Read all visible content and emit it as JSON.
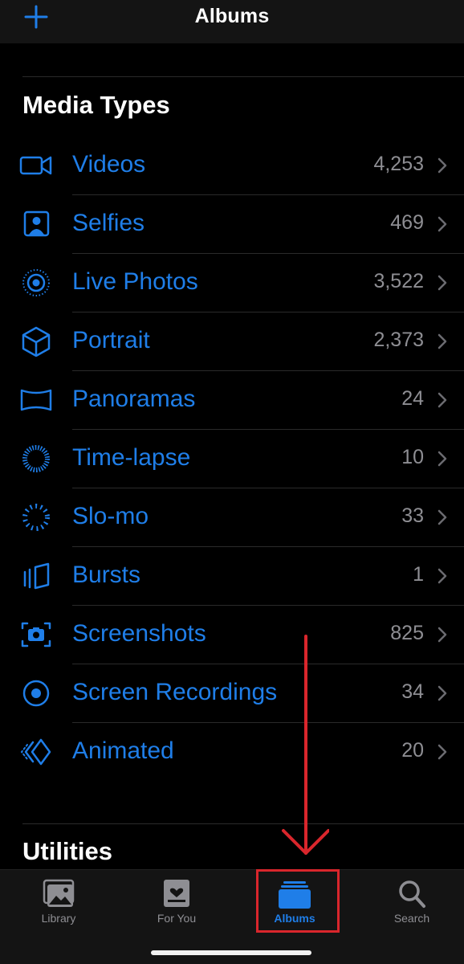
{
  "header": {
    "title": "Albums",
    "add_icon": "plus-icon"
  },
  "media_types": {
    "title": "Media Types",
    "items": [
      {
        "label": "Videos",
        "count": "4,253",
        "icon": "video-icon"
      },
      {
        "label": "Selfies",
        "count": "469",
        "icon": "selfie-icon"
      },
      {
        "label": "Live Photos",
        "count": "3,522",
        "icon": "live-photos-icon"
      },
      {
        "label": "Portrait",
        "count": "2,373",
        "icon": "portrait-cube-icon"
      },
      {
        "label": "Panoramas",
        "count": "24",
        "icon": "panorama-icon"
      },
      {
        "label": "Time-lapse",
        "count": "10",
        "icon": "time-lapse-icon"
      },
      {
        "label": "Slo-mo",
        "count": "33",
        "icon": "slo-mo-icon"
      },
      {
        "label": "Bursts",
        "count": "1",
        "icon": "bursts-icon"
      },
      {
        "label": "Screenshots",
        "count": "825",
        "icon": "screenshot-icon"
      },
      {
        "label": "Screen Recordings",
        "count": "34",
        "icon": "screen-recording-icon"
      },
      {
        "label": "Animated",
        "count": "20",
        "icon": "animated-icon"
      }
    ]
  },
  "utilities": {
    "title": "Utilities"
  },
  "tabbar": {
    "tabs": [
      {
        "label": "Library",
        "icon": "photo-library-icon",
        "active": false
      },
      {
        "label": "For You",
        "icon": "for-you-icon",
        "active": false
      },
      {
        "label": "Albums",
        "icon": "albums-folder-icon",
        "active": true
      },
      {
        "label": "Search",
        "icon": "search-icon",
        "active": false
      }
    ]
  },
  "colors": {
    "accent": "#1f7ee8",
    "background": "#000000",
    "bar": "#141414",
    "secondary_text": "#8e8e93",
    "annotation_red": "#d9262c"
  }
}
